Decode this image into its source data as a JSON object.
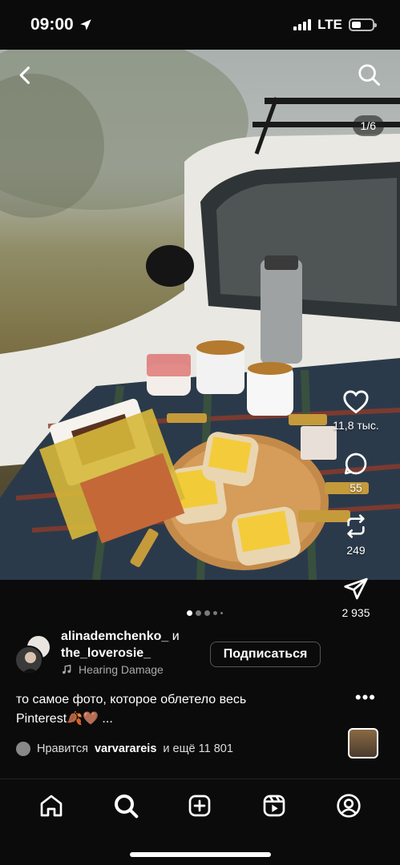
{
  "status_bar": {
    "time": "09:00",
    "network": "LTE"
  },
  "post": {
    "image_counter": "1/6",
    "likes_count": "11,8 тыс.",
    "comments_count": "55",
    "reposts_count": "249",
    "shares_count": "2 935",
    "author_primary": "alinademchenko_",
    "author_conjunction": "и",
    "author_secondary": "the_loverosie_",
    "music": "Hearing Damage",
    "follow_label": "Подписаться",
    "caption_line1": "то самое фото, которое облетело весь",
    "caption_line2": "Pinterest🍂🤎 ...",
    "liked_by_prefix": "Нравится",
    "liked_by_user": "varvarareis",
    "liked_by_suffix": "и ещё 11 801",
    "carousel_total": 5,
    "carousel_active": 1
  },
  "icons": {
    "back": "chevron-left-icon",
    "search": "search-icon",
    "like": "heart-icon",
    "comment": "comment-icon",
    "repost": "repost-icon",
    "share": "send-icon",
    "more": "more-icon",
    "music": "music-note-icon"
  },
  "nav": {
    "tabs": [
      "home",
      "search",
      "create",
      "reels",
      "profile"
    ],
    "active": "search"
  }
}
